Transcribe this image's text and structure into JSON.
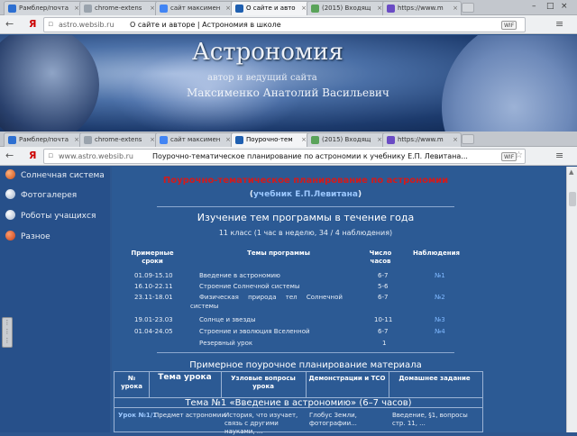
{
  "window1": {
    "tabs": [
      {
        "label": "Рамблер/почта",
        "fav": "#2d6fd1"
      },
      {
        "label": "chrome-extens",
        "fav": "#9aa3ad"
      },
      {
        "label": "сайт максимен",
        "fav": "#4285f4"
      },
      {
        "label": "О сайте и авто",
        "fav": "#1f5fb0"
      },
      {
        "label": "(2015) Входящ",
        "fav": "#5aa35a"
      },
      {
        "label": "https://www.m",
        "fav": "#6a4bc4"
      }
    ],
    "address": {
      "url": "astro.websib.ru",
      "title": "О сайте и авторе | Астрономия в школе",
      "badge": "WIF"
    }
  },
  "banner": {
    "title": "Астрономия",
    "subtitle": "автор и ведущий сайта",
    "author": "Максименко Анатолий Васильевич"
  },
  "window2": {
    "tabs": [
      {
        "label": "Рамблер/почта",
        "fav": "#2d6fd1"
      },
      {
        "label": "chrome-extens",
        "fav": "#9aa3ad"
      },
      {
        "label": "сайт максимен",
        "fav": "#4285f4"
      },
      {
        "label": "Поурочно-тем",
        "fav": "#1f5fb0"
      },
      {
        "label": "(2015) Входящ",
        "fav": "#5aa35a"
      },
      {
        "label": "https://www.m",
        "fav": "#6a4bc4"
      }
    ],
    "address": {
      "url": "www.astro.websib.ru",
      "title": "Поурочно-тематическое планирование по астрономии к учебнику Е.П. Левитана...",
      "badge": "WIF"
    }
  },
  "sidebar": {
    "items": [
      {
        "label": "Солнечная система",
        "color": "#d8612a"
      },
      {
        "label": "Фотогалерея",
        "color": "#e8eef8"
      },
      {
        "label": "Роботы учащихся",
        "color": "#e8eef8"
      },
      {
        "label": "Разное",
        "color": "#d8612a"
      }
    ]
  },
  "content": {
    "heading": "Поурочно-тематическое планирование по астрономии",
    "textbook_pre": "(",
    "textbook_link": "учебник Е.П.Левитана",
    "textbook_post": ")",
    "study_title": "Изучение тем программы в течение года",
    "grade_line": "11 класс (1 час в неделю, 34 / 4 наблюдения)",
    "headers": {
      "dates": "Примерные сроки",
      "topics": "Темы программы",
      "hours": "Число часов",
      "obs": "Наблюдения"
    },
    "rows": [
      {
        "dates": "01.09-15.10",
        "topic": "Введение в астрономию",
        "hours": "6-7",
        "obs": "№1"
      },
      {
        "dates": "16.10-22.11",
        "topic": "Строение Солнечной системы",
        "hours": "5-6",
        "obs": ""
      },
      {
        "dates": "23.11-18.01",
        "topic": "Физическая природа тел Солнечной",
        "topic2": "системы",
        "hours": "6-7",
        "obs": "№2"
      },
      {
        "dates": "19.01-23.03",
        "topic": "Солнце и звезды",
        "hours": "10-11",
        "obs": "№3"
      },
      {
        "dates": "01.04-24.05",
        "topic": "Строение и эволюция Вселенной",
        "hours": "6-7",
        "obs": "№4"
      },
      {
        "dates": "",
        "topic": "Резервный урок",
        "hours": "1",
        "obs": ""
      }
    ],
    "plan_title": "Примерное поурочное планирование материала",
    "plan_headers": {
      "num": "№ урока",
      "lesson": "Тема урока",
      "questions": "Узловые вопросы урока",
      "demo": "Демонстрации и ТСО",
      "hw": "Домашнее задание"
    },
    "topic_banner": "Тема №1 «Введение в астрономию» (6–7 часов)",
    "first_row": {
      "num": "Урок №1/1",
      "lesson": "Предмет астрономии",
      "questions": "История, что изучает, связь с другими науками, ...",
      "demo": "Глобус Земли, фотографии...",
      "hw": "Введение, §1, вопросы стр. 11, ..."
    }
  }
}
